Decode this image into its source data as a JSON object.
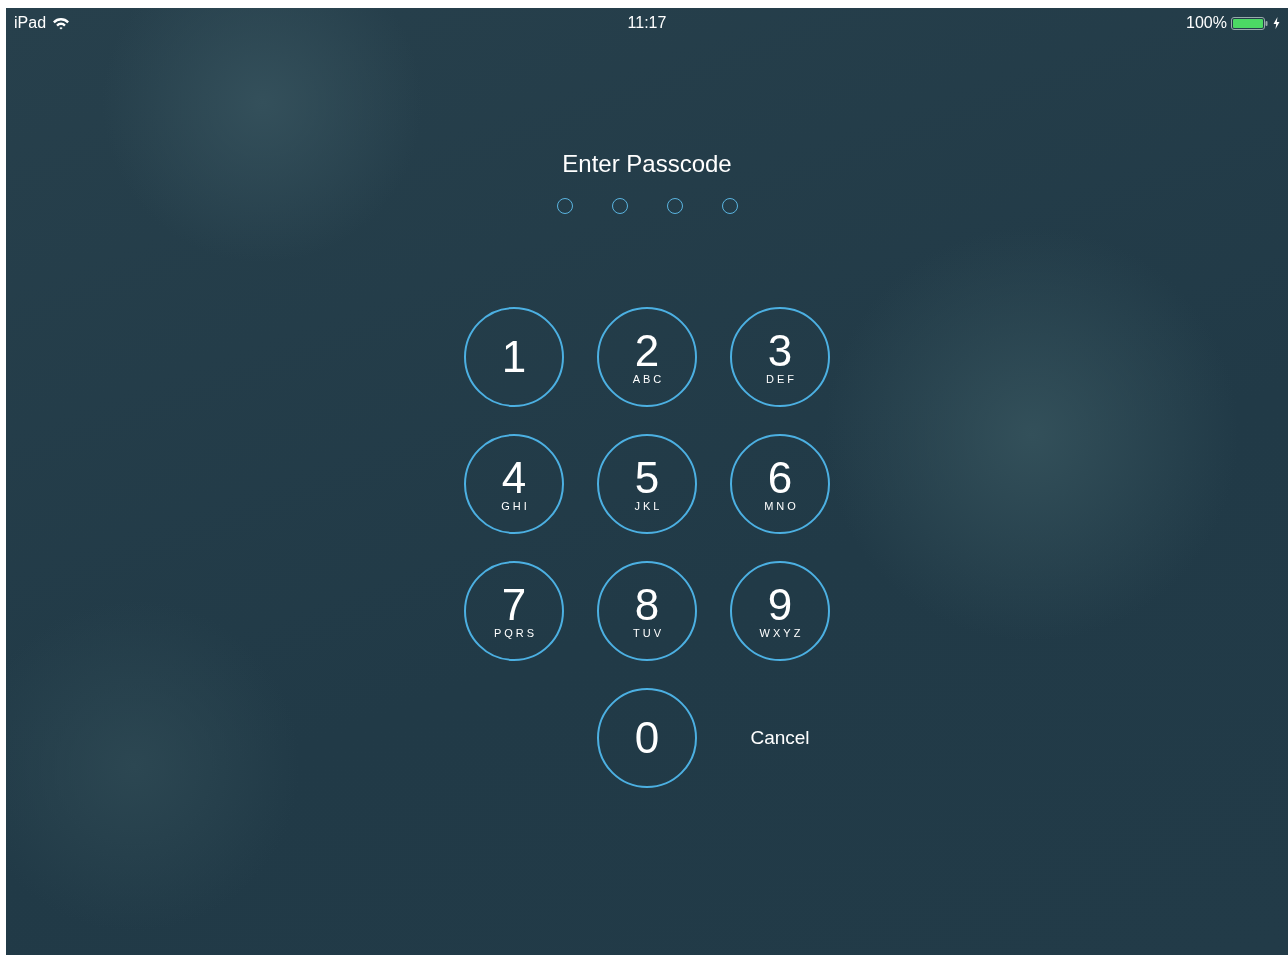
{
  "status_bar": {
    "device": "iPad",
    "time": "11:17",
    "battery_percent": "100%"
  },
  "title": "Enter Passcode",
  "passcode_dots": [
    {
      "filled": false
    },
    {
      "filled": false
    },
    {
      "filled": false
    },
    {
      "filled": false
    }
  ],
  "keys": [
    {
      "digit": "1"
    },
    {
      "digit": "2",
      "letters": "ABC"
    },
    {
      "digit": "3",
      "letters": "DEF"
    },
    {
      "digit": "4",
      "letters": "GHI"
    },
    {
      "digit": "5",
      "letters": "JKL"
    },
    {
      "digit": "6",
      "letters": "MNO"
    },
    {
      "digit": "7",
      "letters": "PQRS"
    },
    {
      "digit": "8",
      "letters": "TUV"
    },
    {
      "digit": "9",
      "letters": "WXYZ"
    },
    {
      "digit": "0"
    }
  ],
  "cancel": "Cancel"
}
